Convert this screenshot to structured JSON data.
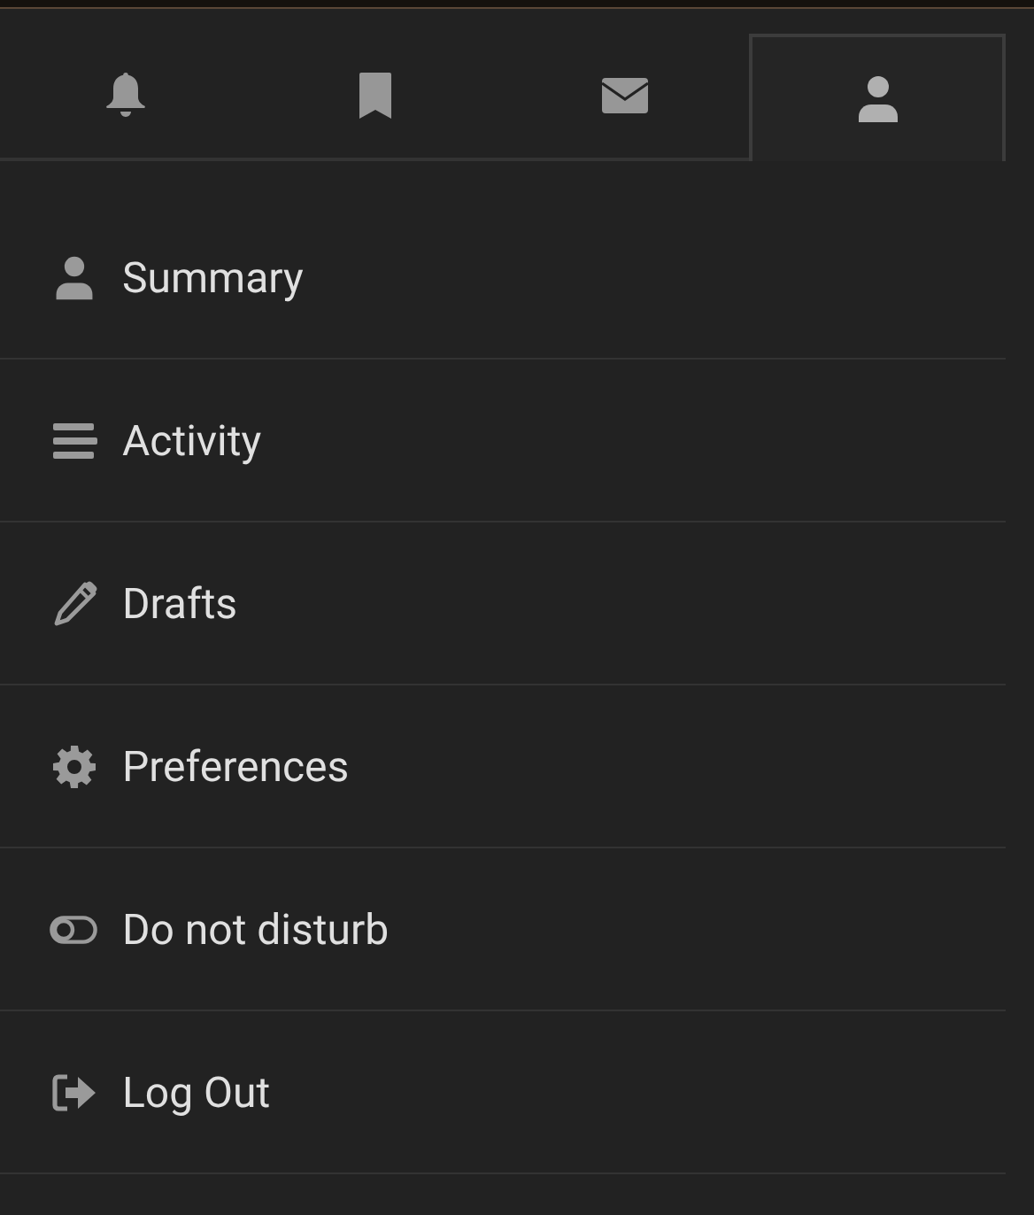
{
  "tabs": [
    {
      "selected": false
    },
    {
      "selected": false
    },
    {
      "selected": false
    },
    {
      "selected": true
    }
  ],
  "menu": [
    {
      "kind": "link",
      "label": "Summary"
    },
    {
      "kind": "link",
      "label": "Activity"
    },
    {
      "kind": "link",
      "label": "Drafts"
    },
    {
      "kind": "link",
      "label": "Preferences"
    },
    {
      "kind": "toggle",
      "label": "Do not disturb",
      "on": false
    },
    {
      "kind": "link",
      "label": "Log Out"
    }
  ]
}
